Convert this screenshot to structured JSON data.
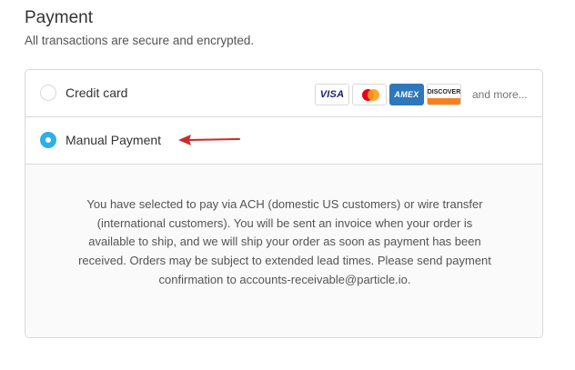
{
  "section": {
    "title": "Payment",
    "subtitle": "All transactions are secure and encrypted."
  },
  "options": [
    {
      "label": "Credit card",
      "selected": false,
      "cards": [
        {
          "name": "visa-card-icon",
          "text": "VISA"
        },
        {
          "name": "mastercard-card-icon",
          "text": ""
        },
        {
          "name": "amex-card-icon",
          "text": "AMEX"
        },
        {
          "name": "discover-card-icon",
          "text": "DISCOVER"
        }
      ],
      "more_text": "and more..."
    },
    {
      "label": "Manual Payment",
      "selected": true,
      "description": "You have selected to pay via ACH (domestic US customers) or wire transfer (international customers). You will be sent an invoice when your order is available to ship, and we will ship your order as soon as payment has been received. Orders may be subject to extended lead times. Please send payment confirmation to accounts-receivable@particle.io."
    }
  ],
  "colors": {
    "radio_selected": "#2cb0e8",
    "annotation_arrow": "#d0282b",
    "border": "#d9d9d9",
    "info_background": "#fafafa"
  }
}
